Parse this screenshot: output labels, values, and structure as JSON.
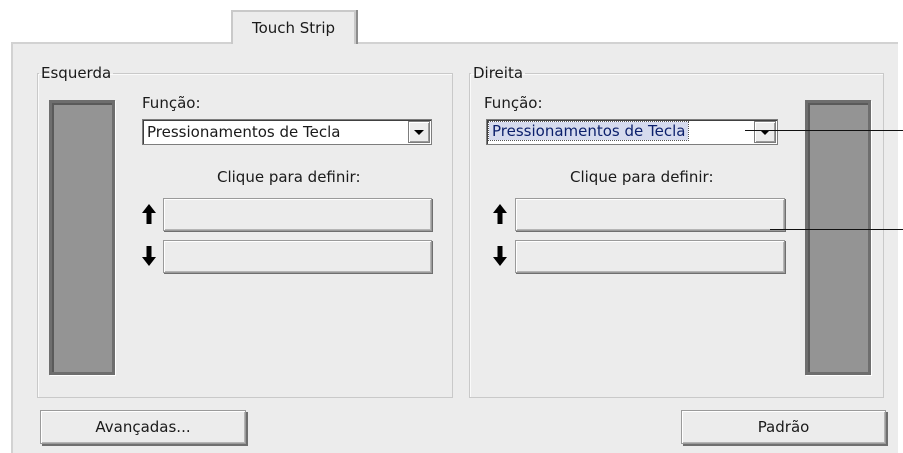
{
  "tab": {
    "label": "Touch Strip"
  },
  "left": {
    "legend": "Esquerda",
    "function_label": "Função:",
    "function_value": "Pressionamentos de Tecla",
    "click_label": "Clique para definir:",
    "up_icon": "arrow-up-icon",
    "down_icon": "arrow-down-icon"
  },
  "right": {
    "legend": "Direita",
    "function_label": "Função:",
    "function_value": "Pressionamentos de Tecla",
    "click_label": "Clique para definir:",
    "up_icon": "arrow-up-icon",
    "down_icon": "arrow-down-icon"
  },
  "buttons": {
    "advanced": "Avançadas...",
    "default": "Padrão"
  }
}
